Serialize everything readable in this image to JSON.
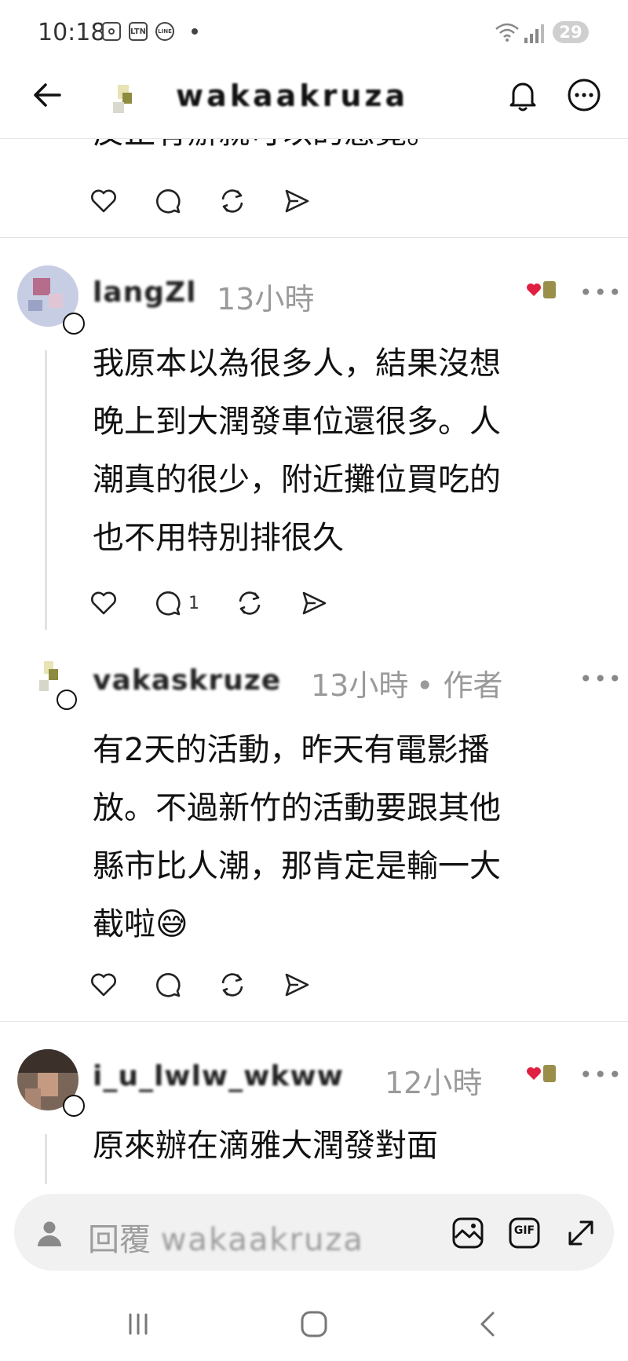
{
  "status_bar": {
    "time": "10:18",
    "notification_icons": [
      "screenshot-icon",
      "ltn-icon",
      "line-icon",
      "dot-icon"
    ],
    "ltn_label": "LTN",
    "line_label": "LINE",
    "battery": "29"
  },
  "header": {
    "title": "wakaakruza"
  },
  "posts": [
    {
      "text": "反正有辦就可以的感覺。",
      "actions": {
        "reply_count": ""
      }
    },
    {
      "username": "langZl",
      "time": "13小時",
      "text": "我原本以為很多人，結果沒想\n晚上到大潤發車位還很多。人\n潮真的很少，附近攤位買吃的\n也不用特別排很久",
      "liked_by_author": true,
      "actions": {
        "reply_count": "1"
      }
    },
    {
      "username": "vakaskruze",
      "time": "13小時",
      "author_tag": "• 作者",
      "text": "有2天的活動，昨天有電影播\n放。不過新竹的活動要跟其他\n縣市比人潮，那肯定是輸一大\n截啦😅",
      "actions": {
        "reply_count": ""
      }
    },
    {
      "username": "i_u_lwlw_wkww",
      "time": "12小時",
      "text": "原來辦在滴雅大潤發對面\n人這麼少",
      "liked_by_author": true
    }
  ],
  "reply_bar": {
    "placeholder_prefix": "回覆",
    "placeholder_name": "wakaakruza",
    "gif_label": "GIF"
  },
  "colors": {
    "like_heart": "#e02040",
    "meta_gray": "#9a9a9a",
    "divider": "#e3e3e3"
  }
}
